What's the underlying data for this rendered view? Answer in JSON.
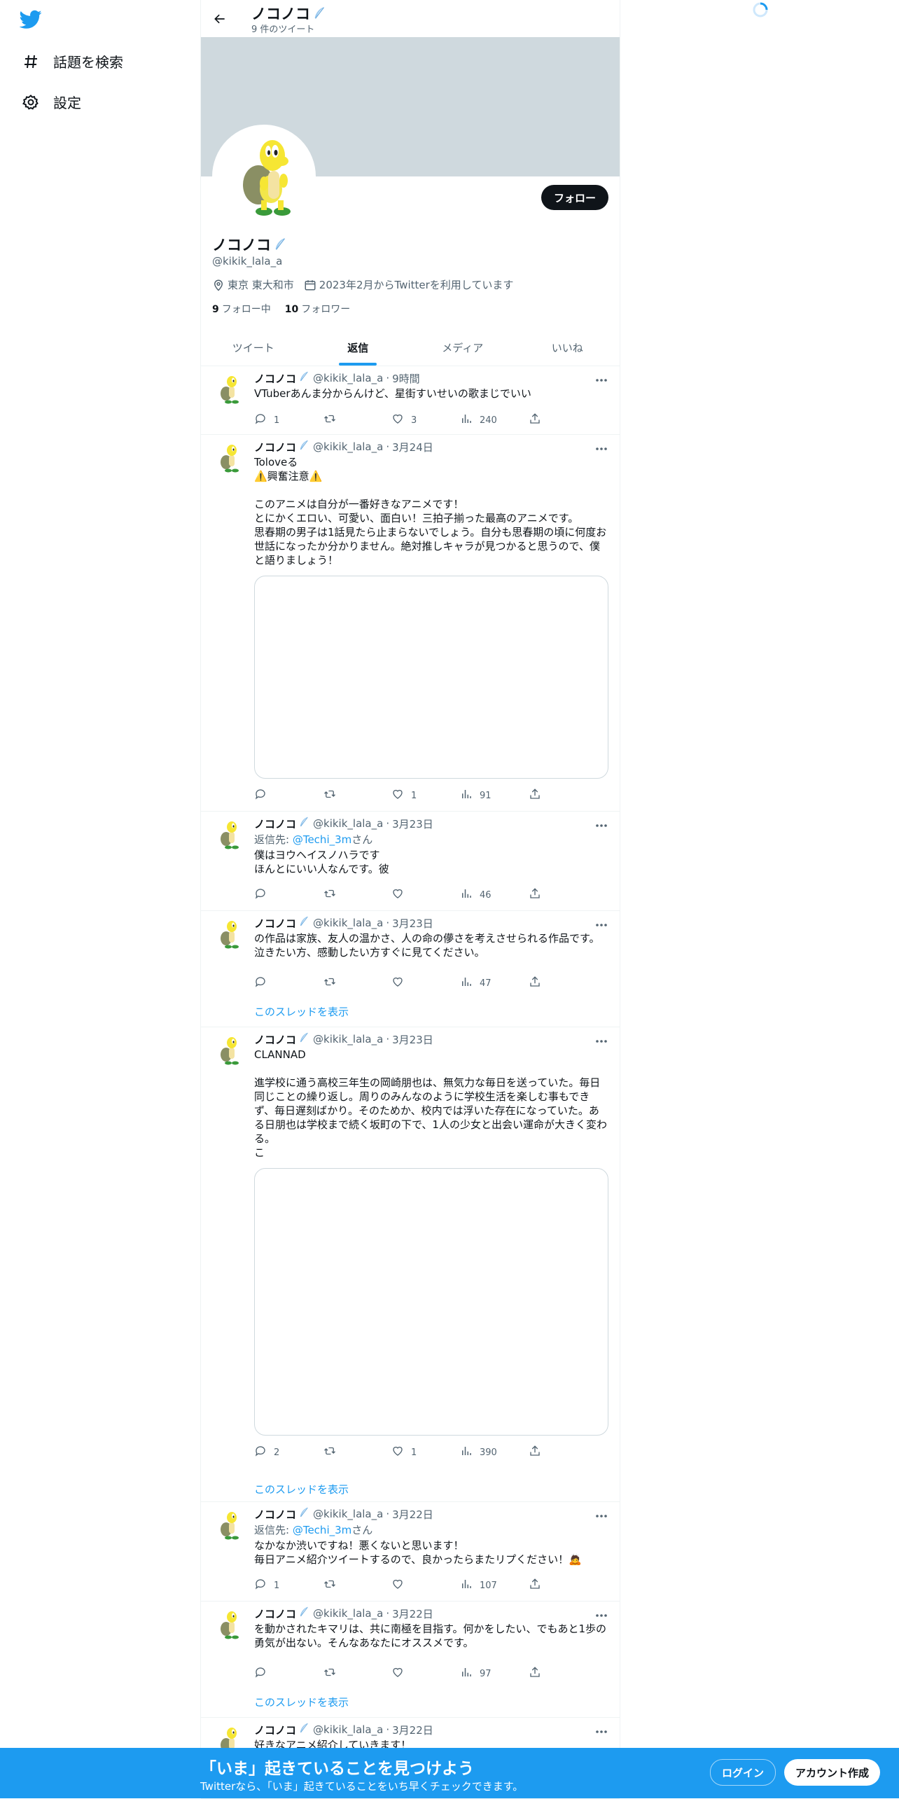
{
  "nav": {
    "explore_label": "話題を検索",
    "settings_label": "設定"
  },
  "header": {
    "title": "ノコノコ",
    "tweet_count": "9 件のツイート"
  },
  "profile": {
    "name": "ノコノコ",
    "handle": "@kikik_lala_a",
    "follow_label": "フォロー",
    "location": "東京 東大和市",
    "joined": "2023年2月からTwitterを利用しています",
    "following_count": "9",
    "following_label": "フォロー中",
    "followers_count": "10",
    "followers_label": "フォロワー"
  },
  "tabs": [
    {
      "label": "ツイート",
      "active": false
    },
    {
      "label": "返信",
      "active": true
    },
    {
      "label": "メディア",
      "active": false
    },
    {
      "label": "いいね",
      "active": false
    }
  ],
  "tweets": [
    {
      "name": "ノコノコ",
      "handle": "@kikik_lala_a",
      "time": "9時間",
      "reply_to": "",
      "text": "VTuberあんま分からんけど、星街すいせいの歌まじでいい",
      "replies": "1",
      "retweets": "",
      "likes": "3",
      "views": "240"
    },
    {
      "name": "ノコノコ",
      "handle": "@kikik_lala_a",
      "time": "3月24日",
      "reply_to": "",
      "text": "Toloveる\n⚠️興奮注意⚠️\n\nこのアニメは自分が一番好きなアニメです！\nとにかくエロい、可愛い、面白い！三拍子揃った最高のアニメです。\n思春期の男子は1話見たら止まらないでしょう。自分も思春期の頃に何度お世話になったか分かりません。絶対推しキャラが見つかると思うので、僕と語りましょう！",
      "replies": "",
      "retweets": "",
      "likes": "1",
      "views": "91"
    },
    {
      "name": "ノコノコ",
      "handle": "@kikik_lala_a",
      "time": "3月23日",
      "reply_label": "返信先:",
      "reply_to": "@Techi_3m",
      "reply_suffix": "さん",
      "text": "僕はヨウヘイスノハラです\nほんとにいい人なんです。彼",
      "replies": "",
      "retweets": "",
      "likes": "",
      "views": "46"
    },
    {
      "name": "ノコノコ",
      "handle": "@kikik_lala_a",
      "time": "3月23日",
      "reply_to": "",
      "text": "の作品は家族、友人の温かさ、人の命の儚さを考えさせられる作品です。泣きたい方、感動したい方すぐに見てください。",
      "replies": "",
      "retweets": "",
      "likes": "",
      "views": "47",
      "thread_label": "このスレッドを表示"
    },
    {
      "name": "ノコノコ",
      "handle": "@kikik_lala_a",
      "time": "3月23日",
      "reply_to": "",
      "text": "CLANNAD\n\n進学校に通う高校三年生の岡崎朋也は、無気力な毎日を送っていた。毎日同じことの繰り返し。周りのみんなのように学校生活を楽しむ事もできず、毎日遅刻ばかり。そのためか、校内では浮いた存在になっていた。ある日朋也は学校まで続く坂町の下で、1人の少女と出会い運命が大きく変わる。\nこ",
      "replies": "2",
      "retweets": "",
      "likes": "1",
      "views": "390",
      "thread_label": "このスレッドを表示"
    },
    {
      "name": "ノコノコ",
      "handle": "@kikik_lala_a",
      "time": "3月22日",
      "reply_label": "返信先:",
      "reply_to": "@Techi_3m",
      "reply_suffix": "さん",
      "text": "なかなか渋いですね！悪くないと思います！\n毎日アニメ紹介ツイートするので、良かったらまたリプください！🙇",
      "replies": "1",
      "retweets": "",
      "likes": "",
      "views": "107"
    },
    {
      "name": "ノコノコ",
      "handle": "@kikik_lala_a",
      "time": "3月22日",
      "reply_to": "",
      "text": "を動かされたキマリは、共に南極を目指す。何かをしたい、でもあと1歩の勇気が出ない。そんなあなたにオススメです。",
      "replies": "",
      "retweets": "",
      "likes": "",
      "views": "97",
      "thread_label": "このスレッドを表示"
    },
    {
      "name": "ノコノコ",
      "handle": "@kikik_lala_a",
      "time": "3月22日",
      "reply_to": "",
      "text": "好きなアニメ紹介していきます！"
    }
  ],
  "bottom_bar": {
    "title": "「いま」起きていることを見つけよう",
    "subtitle": "Twitterなら、「いま」起きていることをいち早くチェックできます。",
    "login_label": "ログイン",
    "signup_label": "アカウント作成"
  },
  "colors": {
    "accent": "#1d9bf0",
    "banner": "#cfd9de",
    "text_secondary": "#536471",
    "dark_button": "#0f1419"
  },
  "icons": {
    "logo": "twitter-bird-icon",
    "explore": "hashtag-icon",
    "settings": "gear-icon",
    "back": "arrow-left-icon",
    "location": "location-pin-icon",
    "calendar": "calendar-icon",
    "reply": "reply-icon",
    "retweet": "retweet-icon",
    "like": "heart-icon",
    "views": "views-icon",
    "share": "share-icon",
    "more": "more-icon",
    "emoji": "feather-emoji-icon"
  }
}
